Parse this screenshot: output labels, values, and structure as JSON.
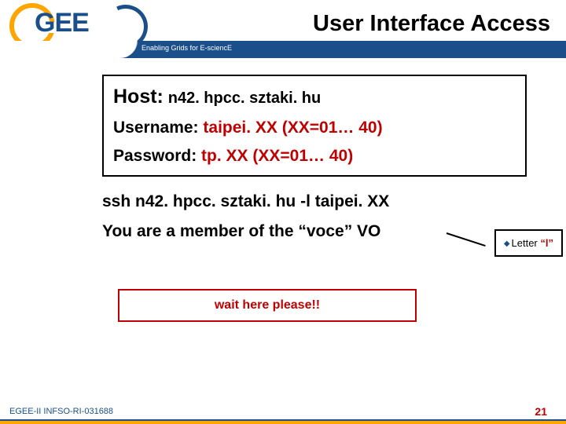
{
  "header": {
    "title": "User Interface Access",
    "tagline": "Enabling Grids for E-sciencE",
    "logo_text": "GEE"
  },
  "box": {
    "host_label": "Host:",
    "host_value": "n42. hpcc. sztaki. hu",
    "username_label": "Username:",
    "username_value": "taipei. XX (XX=01… 40)",
    "password_label": "Password:",
    "password_value": "tp. XX (XX=01… 40)"
  },
  "body": {
    "ssh_cmd": "ssh n42. hpcc. sztaki. hu -l taipei. XX",
    "member_line": "You are a member of the “voce” VO"
  },
  "callout": {
    "prefix": "Letter ",
    "letter": "“l”"
  },
  "wait": "wait here please!!",
  "footer": {
    "left": "EGEE-II INFSO-RI-031688",
    "page": "21"
  }
}
